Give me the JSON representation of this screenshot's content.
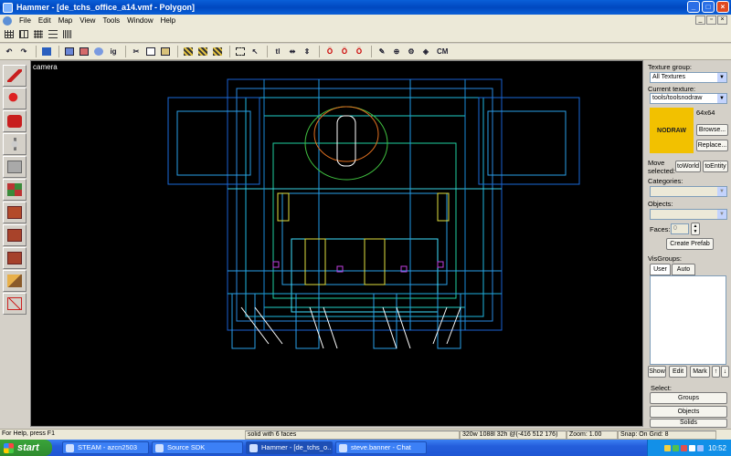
{
  "window": {
    "title": "Hammer - [de_tchs_office_a14.vmf - Polygon]"
  },
  "menu": [
    "File",
    "Edit",
    "Map",
    "View",
    "Tools",
    "Window",
    "Help"
  ],
  "toolbar3": {
    "cm_label": "CM"
  },
  "viewport": {
    "label": "camera"
  },
  "texture": {
    "group_label": "Texture group:",
    "group_value": "All Textures",
    "current_label": "Current texture:",
    "current_value": "tools/toolsnodraw",
    "size": "64x64",
    "preview_text": "NODRAW",
    "browse": "Browse...",
    "replace": "Replace..."
  },
  "move": {
    "label": "Move selected:",
    "to_world": "toWorld",
    "to_entity": "toEntity"
  },
  "categories": {
    "label": "Categories:"
  },
  "objects": {
    "label": "Objects:"
  },
  "faces": {
    "label": "Faces:",
    "value": "0"
  },
  "create_prefab": "Create Prefab",
  "visgroups": {
    "label": "VisGroups:",
    "tabs": [
      "User",
      "Auto"
    ],
    "show": "Show",
    "edit": "Edit",
    "mark": "Mark"
  },
  "select": {
    "label": "Select:",
    "groups": "Groups",
    "objects": "Objects",
    "solids": "Solids"
  },
  "status": {
    "help": "For Help, press F1",
    "selection": "solid with 6 faces",
    "dims": "320w 1088l 32h @(-416 512 176)",
    "zoom": "Zoom: 1.00",
    "snap": "Snap: On Grid: 8"
  },
  "taskbar": {
    "start": "start",
    "tasks": [
      "STEAM - azcn2503",
      "Source SDK",
      "Hammer - [de_tchs_o...",
      "steve.banner - Chat"
    ],
    "clock": "10:52"
  },
  "colors": {
    "accent": "#0a5fd8",
    "texture_preview": "#f2c100",
    "viewport_bg": "#000000"
  }
}
